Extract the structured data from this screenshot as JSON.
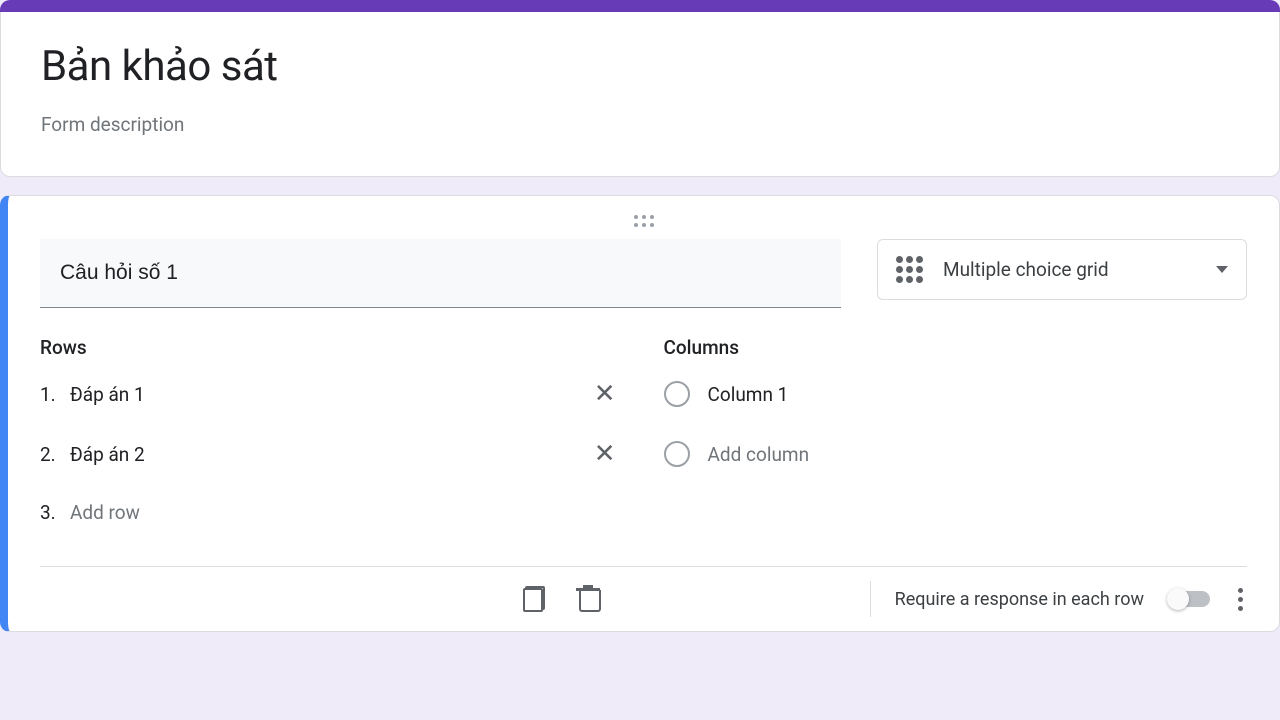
{
  "header": {
    "title": "Bản khảo sát",
    "description_placeholder": "Form description"
  },
  "question": {
    "text": "Câu hỏi số 1",
    "type_label": "Multiple choice grid",
    "rows_label": "Rows",
    "columns_label": "Columns",
    "rows": [
      {
        "num": "1.",
        "text": "Đáp án 1"
      },
      {
        "num": "2.",
        "text": "Đáp án 2"
      }
    ],
    "add_row_num": "3.",
    "add_row_placeholder": "Add row",
    "columns": [
      {
        "text": "Column 1"
      }
    ],
    "add_column_placeholder": "Add column"
  },
  "footer": {
    "require_label": "Require a response in each row"
  }
}
